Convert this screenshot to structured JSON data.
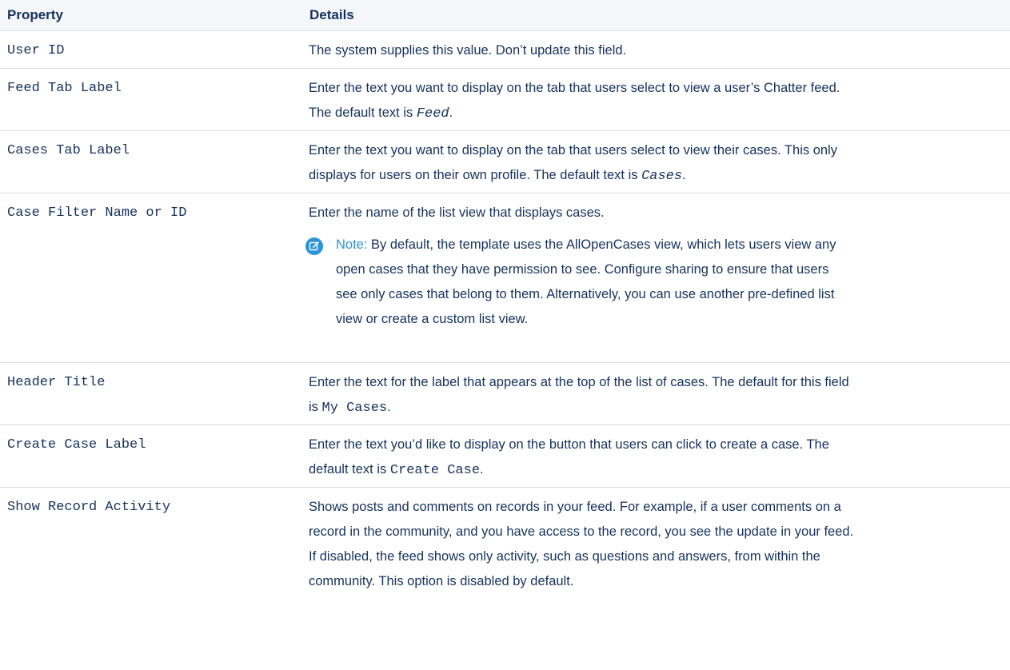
{
  "header": {
    "property": "Property",
    "details": "Details"
  },
  "rows": [
    {
      "property": "User ID",
      "details": "The system supplies this value. Don’t update this field."
    },
    {
      "property": "Feed Tab Label",
      "details_line1": "Enter the text you want to display on the tab that users select to view a user’s Chatter feed.",
      "details_pre": "The default text is ",
      "details_code": "Feed",
      "details_post": "."
    },
    {
      "property": "Cases Tab Label",
      "details_line1": "Enter the text you want to display on the tab that users select to view their cases. This only",
      "details_pre": "displays for users on their own profile. The default text is ",
      "details_code": "Cases",
      "details_post": "."
    },
    {
      "property": "Case Filter Name or ID",
      "details": "Enter the name of the list view that displays cases.",
      "note": {
        "label": "Note:",
        "line1": " By default, the template uses the AllOpenCases view, which lets users view any",
        "line2": "open cases that they have permission to see. Configure sharing to ensure that users",
        "line3": "see only cases that belong to them. Alternatively, you can use another pre-defined list",
        "line4": "view or create a custom list view.",
        "icon": "edit-note-icon"
      }
    },
    {
      "property": "Header Title",
      "details_line1": "Enter the text for the label that appears at the top of the list of cases. The default for this field",
      "details_pre": "is ",
      "details_code": "My Cases",
      "details_post": "."
    },
    {
      "property": "Create Case Label",
      "details_line1": "Enter the text you’d like to display on the button that users can click to create a case. The",
      "details_pre": "default text is ",
      "details_code": "Create Case",
      "details_post": "."
    },
    {
      "property": "Show Record Activity",
      "line1": "Shows posts and comments on records in your feed. For example, if a user comments on a",
      "line2": "record in the community, and you have access to the record, you see the update in your feed.",
      "line3": "If disabled, the feed shows only activity, such as questions and answers, from within the",
      "line4": "community. This option is disabled by default."
    }
  ],
  "colors": {
    "text": "#16325c",
    "header_bg": "#f4f6f9",
    "border": "#d8dde6",
    "note_accent": "#2a94d6"
  }
}
